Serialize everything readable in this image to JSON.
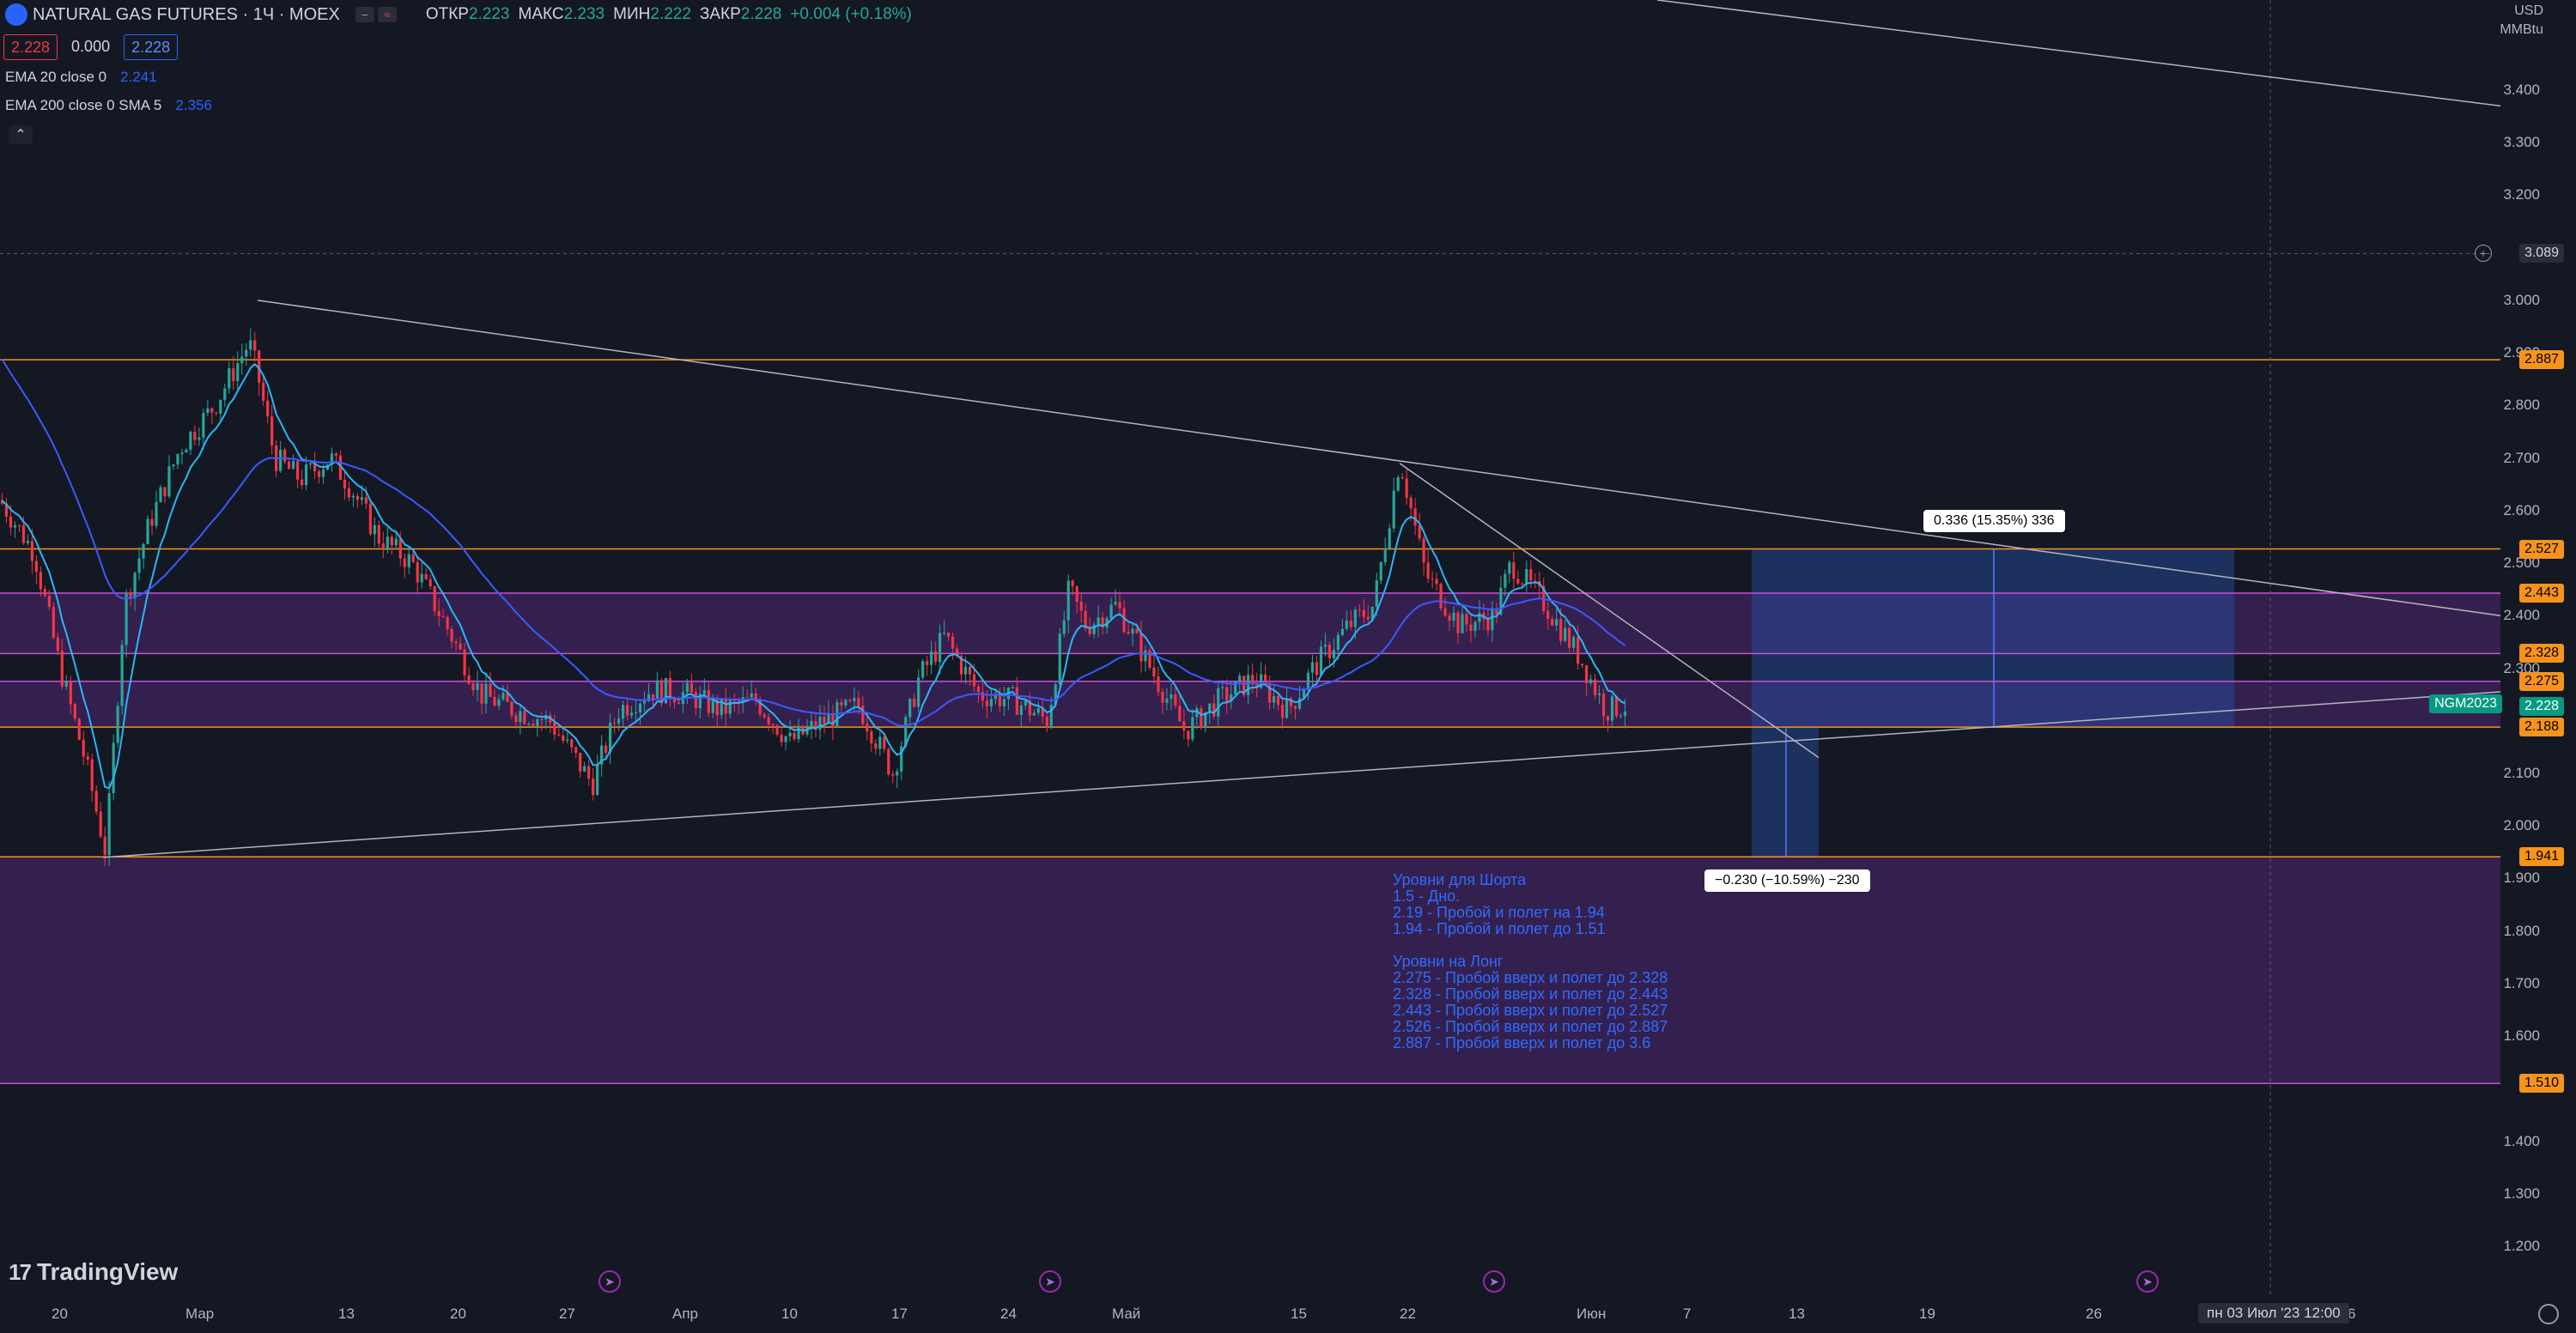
{
  "header": {
    "title": "NATURAL GAS FUTURES · 1Ч · MOEX",
    "ohlc": [
      {
        "k": "ОТКР",
        "v": "2.223"
      },
      {
        "k": "МАКС",
        "v": "2.233"
      },
      {
        "k": "МИН",
        "v": "2.222"
      },
      {
        "k": "ЗАКР",
        "v": "2.228"
      },
      {
        "k": "",
        "v": "+0.004 (+0.18%)"
      }
    ],
    "bid": "2.228",
    "spread": "0.000",
    "ask": "2.228"
  },
  "indicators": [
    {
      "label": "EMA 20 close 0",
      "value": "2.241"
    },
    {
      "label": "EMA 200 close 0 SMA 5",
      "value": "2.356"
    }
  ],
  "currency": {
    "line1": "USD",
    "line2": "MMBtu"
  },
  "yaxis": {
    "min": 1.2,
    "max": 3.4,
    "ticks": [
      "3.400",
      "3.300",
      "3.200",
      "3.000",
      "2.900",
      "2.800",
      "2.700",
      "2.600",
      "2.500",
      "2.400",
      "2.300",
      "2.100",
      "2.000",
      "1.900",
      "1.800",
      "1.700",
      "1.600",
      "1.400",
      "1.300",
      "1.200"
    ],
    "crosshair_value": "3.089"
  },
  "levels": [
    {
      "label": "2.887",
      "kind": "orange"
    },
    {
      "label": "2.527",
      "kind": "orange"
    },
    {
      "label": "2.443",
      "kind": "orange"
    },
    {
      "label": "2.328",
      "kind": "orange"
    },
    {
      "label": "2.275",
      "kind": "orange"
    },
    {
      "label": "2.228",
      "kind": "teal"
    },
    {
      "label": "2.188",
      "kind": "orange"
    },
    {
      "label": "1.941",
      "kind": "orange"
    },
    {
      "label": "1.510",
      "kind": "orange"
    }
  ],
  "ticker_tag": "NGM2023",
  "measure_up": "0.336 (15.35%) 336",
  "measure_down": "−0.230 (−10.59%) −230",
  "notes": "Уровни для Шорта\n1.5 - Дно.\n2.19 - Пробой и полет на 1.94\n1.94 - Пробой и полет до 1.51\n\nУровни на Лонг\n2.275 - Пробой вверх и полет до 2.328\n2.328 - Пробой вверх и полет до 2.443\n2.443 - Пробой вверх и полет до 2.527\n2.526 - Пробой вверх и полет до 2.887\n2.887 - Пробой вверх и полет до 3.6",
  "xaxis": {
    "ticks": [
      "20",
      "Мар",
      "13",
      "20",
      "27",
      "Апр",
      "10",
      "17",
      "24",
      "Май",
      "15",
      "22",
      "Июн",
      "7",
      "13",
      "19",
      "26",
      "6"
    ],
    "crosshair_label": "пн 03 Июл '23   12:00"
  },
  "logo": "TradingView",
  "colors": {
    "background": "#141823",
    "up": "#26a69a",
    "down": "#f23645",
    "ema20": "#29b6f6",
    "ema200": "#3d5afe",
    "level": "#f7931a",
    "zone": "#5b2a86"
  }
}
